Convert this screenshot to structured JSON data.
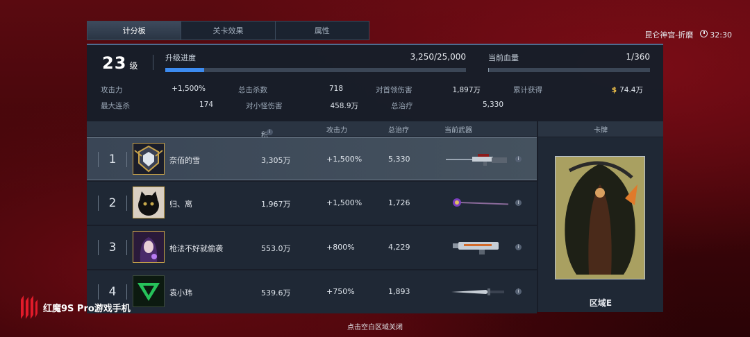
{
  "tabs": [
    {
      "label": "计分板",
      "active": true
    },
    {
      "label": "关卡效果",
      "active": false
    },
    {
      "label": "属性",
      "active": false
    }
  ],
  "map_name": "昆仑神宫-折磨",
  "timer": "32:30",
  "level": {
    "value": "23",
    "unit": "级"
  },
  "upgrade": {
    "label": "升级进度",
    "value": "3,250/25,000",
    "progress": 0.13
  },
  "health": {
    "label": "当前血量",
    "value": "1/360",
    "progress": 0.003
  },
  "stats": [
    [
      {
        "k": "攻击力",
        "v": "+1,500%"
      },
      {
        "k": "总击杀数",
        "v": "718"
      },
      {
        "k": "对首领伤害",
        "v": "1,897万"
      },
      {
        "k": "累计获得",
        "v": "74.4万",
        "coin": "$"
      }
    ],
    [
      {
        "k": "最大连杀",
        "v": "174"
      },
      {
        "k": "对小怪伤害",
        "v": "458.9万"
      },
      {
        "k": "总治疗",
        "v": "5,330"
      }
    ]
  ],
  "table": {
    "headers": {
      "score": "积分",
      "attack": "攻击力",
      "heal": "总治疗",
      "weapon": "当前武器",
      "card": "卡牌"
    },
    "rows": [
      {
        "rank": "1",
        "name": "奈佰的雪",
        "score": "3,305万",
        "attack": "+1,500%",
        "heal": "5,330",
        "weapon": "sniper-rifle",
        "avatar": "emblem"
      },
      {
        "rank": "2",
        "name": "归、离",
        "score": "1,967万",
        "attack": "+1,500%",
        "heal": "1,726",
        "weapon": "magic-staff",
        "avatar": "cat"
      },
      {
        "rank": "3",
        "name": "枪法不好就偷袭",
        "score": "553.0万",
        "attack": "+800%",
        "heal": "4,229",
        "weapon": "heavy-gun",
        "avatar": "girl"
      },
      {
        "rank": "4",
        "name": "袁小玮",
        "score": "539.6万",
        "attack": "+750%",
        "heal": "1,893",
        "weapon": "dagger",
        "avatar": "green-logo"
      }
    ]
  },
  "card": {
    "name": "区域E"
  },
  "footer": "点击空白区域关闭",
  "watermark": "红魔9S Pro游戏手机",
  "colors": {
    "accent": "#3c8bf0",
    "coin": "#f1c24a",
    "background": "#4a070c"
  }
}
